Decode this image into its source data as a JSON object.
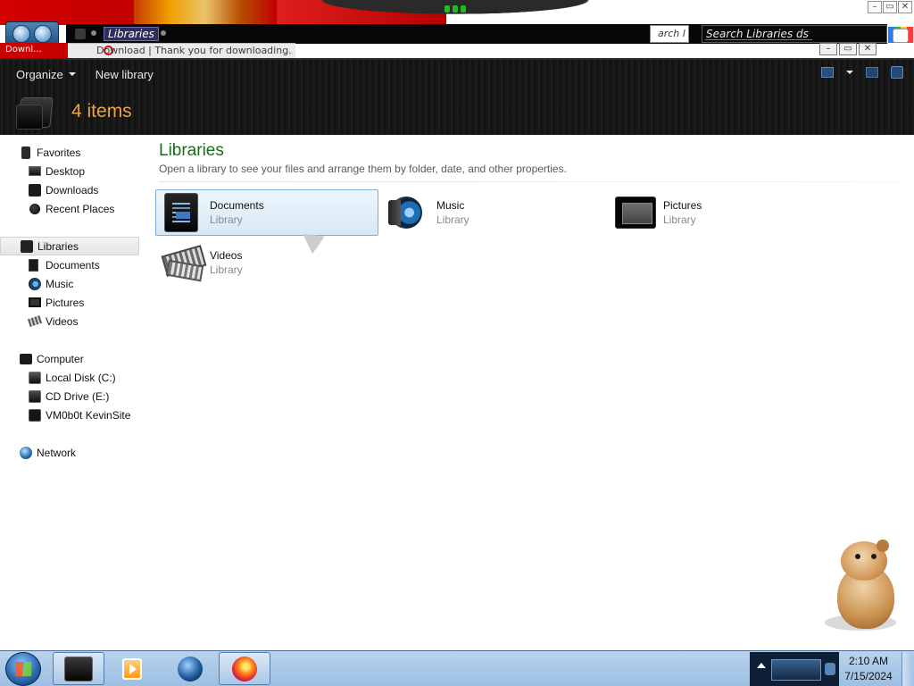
{
  "window": {
    "address_crumb": "Libraries",
    "search_placeholder": "Search Libraries ds",
    "tab_title": "Download | Thank you for downloading...",
    "window_buttons": [
      "–",
      "▭",
      "✕"
    ]
  },
  "command_bar": {
    "organize_label": "Organize",
    "new_library_label": "New library"
  },
  "header": {
    "item_count": "4 items"
  },
  "navigation": {
    "favorites": {
      "label": "Favorites",
      "items": [
        {
          "label": "Desktop",
          "icon": "desktop-icon"
        },
        {
          "label": "Downloads",
          "icon": "downloads-icon"
        },
        {
          "label": "Recent Places",
          "icon": "recent-places-icon"
        }
      ]
    },
    "libraries": {
      "label": "Libraries",
      "items": [
        {
          "label": "Documents",
          "icon": "documents-icon"
        },
        {
          "label": "Music",
          "icon": "music-icon"
        },
        {
          "label": "Pictures",
          "icon": "pictures-icon"
        },
        {
          "label": "Videos",
          "icon": "videos-icon"
        }
      ]
    },
    "computer": {
      "label": "Computer",
      "items": [
        {
          "label": "Local Disk (C:)",
          "icon": "local-disk-icon"
        },
        {
          "label": "CD Drive (E:)",
          "icon": "cd-drive-icon"
        },
        {
          "label": "VM0b0t KevinSite",
          "icon": "network-drive-icon"
        }
      ]
    },
    "network": {
      "label": "Network"
    }
  },
  "content": {
    "title": "Libraries",
    "subtitle": "Open a library to see your files and arrange them by folder, date, and other properties.",
    "libraries": [
      {
        "name": "Documents",
        "kind": "Library",
        "icon": "documents-library-icon"
      },
      {
        "name": "Music",
        "kind": "Library",
        "icon": "music-library-icon"
      },
      {
        "name": "Pictures",
        "kind": "Library",
        "icon": "pictures-library-icon"
      },
      {
        "name": "Videos",
        "kind": "Library",
        "icon": "videos-library-icon"
      }
    ]
  },
  "taskbar": {
    "time": "2:10 AM",
    "date": "7/15/2024",
    "pinned": [
      "windows-explorer-icon",
      "media-player-icon",
      "globe-icon",
      "firefox-icon"
    ]
  },
  "colors": {
    "title_green": "#1d6b1d",
    "item_count_orange": "#e6a548",
    "selection_blue": "#84acd1"
  }
}
